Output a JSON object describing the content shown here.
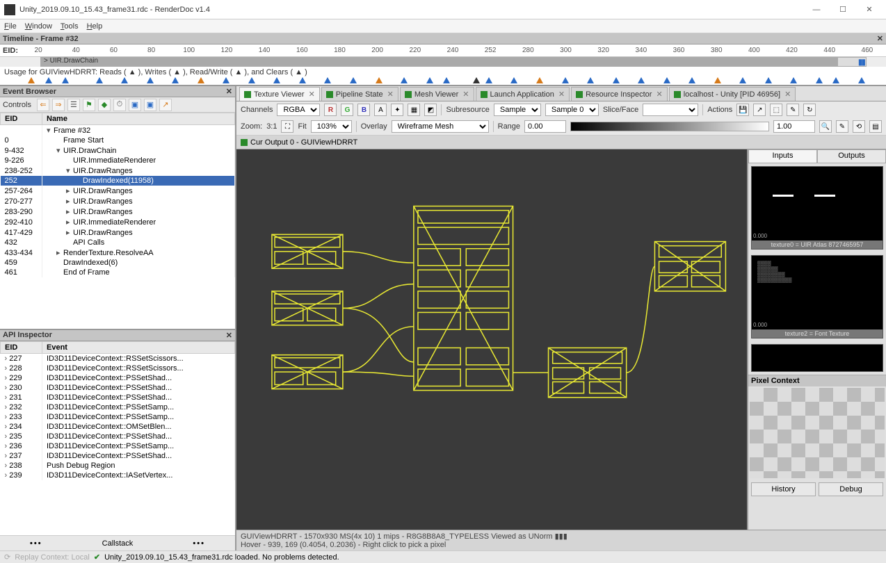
{
  "window": {
    "title": "Unity_2019.09.10_15.43_frame31.rdc - RenderDoc v1.4",
    "min": "—",
    "max": "☐",
    "close": "✕"
  },
  "menu": [
    "File",
    "Window",
    "Tools",
    "Help"
  ],
  "timeline": {
    "title": "Timeline - Frame #32",
    "eid": "EID:",
    "ticks": [
      "20",
      "40",
      "60",
      "80",
      "100",
      "120",
      "140",
      "160",
      "180",
      "200",
      "220",
      "240",
      "252",
      "280",
      "300",
      "320",
      "340",
      "360",
      "380",
      "400",
      "420",
      "440",
      "460"
    ],
    "bar_label": "> UIR.DrawChain",
    "usage_text": "Usage for GUIViewHDRRT: Reads ( ▲ ), Writes ( ▲ ), Read/Write ( ▲ ), and Clears ( ▲ )"
  },
  "event_browser": {
    "title": "Event Browser",
    "controls_label": "Controls",
    "cols": [
      "EID",
      "Name"
    ],
    "rows": [
      {
        "eid": "",
        "name": "Frame #32",
        "indent": 0,
        "chev": "v"
      },
      {
        "eid": "0",
        "name": "Frame Start",
        "indent": 1
      },
      {
        "eid": "9-432",
        "name": "UIR.DrawChain",
        "indent": 1,
        "chev": "v"
      },
      {
        "eid": "9-226",
        "name": "UIR.ImmediateRenderer",
        "indent": 2
      },
      {
        "eid": "238-252",
        "name": "UIR.DrawRanges",
        "indent": 2,
        "chev": "v"
      },
      {
        "eid": "252",
        "name": "DrawIndexed(11958)",
        "indent": 3,
        "sel": true
      },
      {
        "eid": "257-264",
        "name": "UIR.DrawRanges",
        "indent": 2,
        "chev": ">"
      },
      {
        "eid": "270-277",
        "name": "UIR.DrawRanges",
        "indent": 2,
        "chev": ">"
      },
      {
        "eid": "283-290",
        "name": "UIR.DrawRanges",
        "indent": 2,
        "chev": ">"
      },
      {
        "eid": "292-410",
        "name": "UIR.ImmediateRenderer",
        "indent": 2,
        "chev": ">"
      },
      {
        "eid": "417-429",
        "name": "UIR.DrawRanges",
        "indent": 2,
        "chev": ">"
      },
      {
        "eid": "432",
        "name": "API Calls",
        "indent": 2
      },
      {
        "eid": "433-434",
        "name": "RenderTexture.ResolveAA",
        "indent": 1,
        "chev": ">"
      },
      {
        "eid": "459",
        "name": "DrawIndexed(6)",
        "indent": 1
      },
      {
        "eid": "461",
        "name": "End of Frame",
        "indent": 1
      }
    ]
  },
  "api_inspector": {
    "title": "API Inspector",
    "cols": [
      "EID",
      "Event"
    ],
    "rows": [
      {
        "eid": "227",
        "event": "ID3D11DeviceContext::RSSetScissors..."
      },
      {
        "eid": "228",
        "event": "ID3D11DeviceContext::RSSetScissors..."
      },
      {
        "eid": "229",
        "event": "ID3D11DeviceContext::PSSetShad..."
      },
      {
        "eid": "230",
        "event": "ID3D11DeviceContext::PSSetShad..."
      },
      {
        "eid": "231",
        "event": "ID3D11DeviceContext::PSSetShad..."
      },
      {
        "eid": "232",
        "event": "ID3D11DeviceContext::PSSetSamp..."
      },
      {
        "eid": "233",
        "event": "ID3D11DeviceContext::PSSetSamp..."
      },
      {
        "eid": "234",
        "event": "ID3D11DeviceContext::OMSetBlen..."
      },
      {
        "eid": "235",
        "event": "ID3D11DeviceContext::PSSetShad..."
      },
      {
        "eid": "236",
        "event": "ID3D11DeviceContext::PSSetSamp..."
      },
      {
        "eid": "237",
        "event": "ID3D11DeviceContext::PSSetShad..."
      },
      {
        "eid": "238",
        "event": "Push Debug Region"
      },
      {
        "eid": "239",
        "event": "ID3D11DeviceContext::IASetVertex..."
      }
    ],
    "callstack": "Callstack"
  },
  "tabs": [
    {
      "label": "Texture Viewer",
      "active": true
    },
    {
      "label": "Pipeline State"
    },
    {
      "label": "Mesh Viewer"
    },
    {
      "label": "Launch Application"
    },
    {
      "label": "Resource Inspector"
    },
    {
      "label": "localhost - Unity [PID 46956]"
    }
  ],
  "texture_viewer": {
    "channels_label": "Channels",
    "channels_value": "RGBA",
    "subresource_label": "Subresource",
    "subresource_value": "Sample",
    "sample_value": "Sample 0",
    "sliceface_label": "Slice/Face",
    "actions_label": "Actions",
    "zoom_label": "Zoom:",
    "zoom_value": "3:1",
    "fit_label": "Fit",
    "zoom_pct": "103%",
    "overlay_label": "Overlay",
    "overlay_value": "Wireframe Mesh",
    "range_label": "Range",
    "range_min": "0.00",
    "range_max": "1.00",
    "output_label": "Cur Output 0 - GUIViewHDRRT",
    "side_tabs": [
      "Inputs",
      "Outputs"
    ],
    "thumb1_caption": "texture0 = UIR Atlas 8727465957",
    "thumb1_tl": "0.000",
    "thumb2_caption": "texture2 = Font Texture",
    "thumb2_tl": "0.000",
    "pixel_context": "Pixel Context",
    "history_btn": "History",
    "debug_btn": "Debug",
    "footer1": "GUIViewHDRRT - 1570x930 MS(4x 10) 1 mips - R8G8B8A8_TYPELESS Viewed as UNorm ▮▮▮",
    "footer2": "Hover -  939,  169 (0.4054, 0.2036) - Right click to pick a pixel"
  },
  "status": {
    "replay": "Replay Context: Local",
    "loaded": "Unity_2019.09.10_15.43_frame31.rdc loaded. No problems detected."
  }
}
